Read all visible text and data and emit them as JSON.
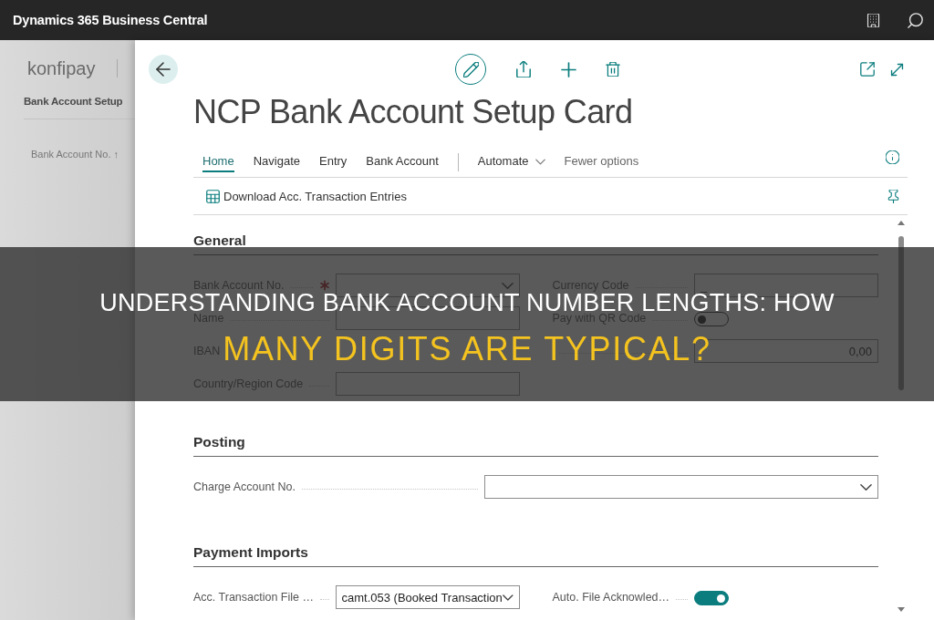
{
  "app_bar": {
    "title": "Dynamics 365 Business Central"
  },
  "background_page": {
    "company": "konfipay",
    "title": "Bank Account Setup",
    "column_header": "Bank Account No. ↑"
  },
  "card": {
    "title": "NCP Bank Account Setup Card",
    "tabs": [
      {
        "label": "Home",
        "selected": true
      },
      {
        "label": "Navigate",
        "selected": false
      },
      {
        "label": "Entry",
        "selected": false
      },
      {
        "label": "Bank Account",
        "selected": false
      }
    ],
    "menu": {
      "label": "Automate"
    },
    "options_link": {
      "label": "Fewer options"
    },
    "actions": [
      {
        "label": "Download Acc. Transaction Entries"
      }
    ],
    "sections": [
      {
        "title": "General",
        "columns": [
          [
            {
              "label": "Bank Account No.",
              "kind": "dropdown",
              "required": true
            },
            {
              "label": "Name",
              "kind": "text",
              "required": false
            },
            {
              "label": "IBAN",
              "kind": "label",
              "required": false
            },
            {
              "label": "Country/Region Code",
              "kind": "text",
              "required": false
            }
          ],
          [
            {
              "label": "Currency Code",
              "kind": "text",
              "required": false,
              "value": "_"
            },
            {
              "label": "Pay with QR Code",
              "kind": "toggle",
              "required": false,
              "on": false
            },
            {
              "kind": "number",
              "required": false,
              "value": "0,00"
            }
          ]
        ]
      },
      {
        "title": "Posting",
        "columns": [
          [
            {
              "label": "Charge Account No.",
              "kind": "dropdown",
              "required": false
            }
          ]
        ]
      },
      {
        "title": "Payment Imports",
        "columns": [
          [
            {
              "label": "Acc. Transaction File …",
              "kind": "dropdown",
              "required": false,
              "value": "camt.053 (Booked Transaction"
            }
          ],
          [
            {
              "label": "Auto. File Acknowled…",
              "kind": "toggle",
              "required": false,
              "on": true
            }
          ]
        ]
      }
    ]
  },
  "banner": {
    "lines": [
      {
        "text": "UNDERSTANDING BANK ACCOUNT NUMBER LENGTHS: HOW",
        "highlight": false
      },
      {
        "text": "MANY DIGITS ARE TYPICAL?",
        "highlight": true
      }
    ]
  }
}
